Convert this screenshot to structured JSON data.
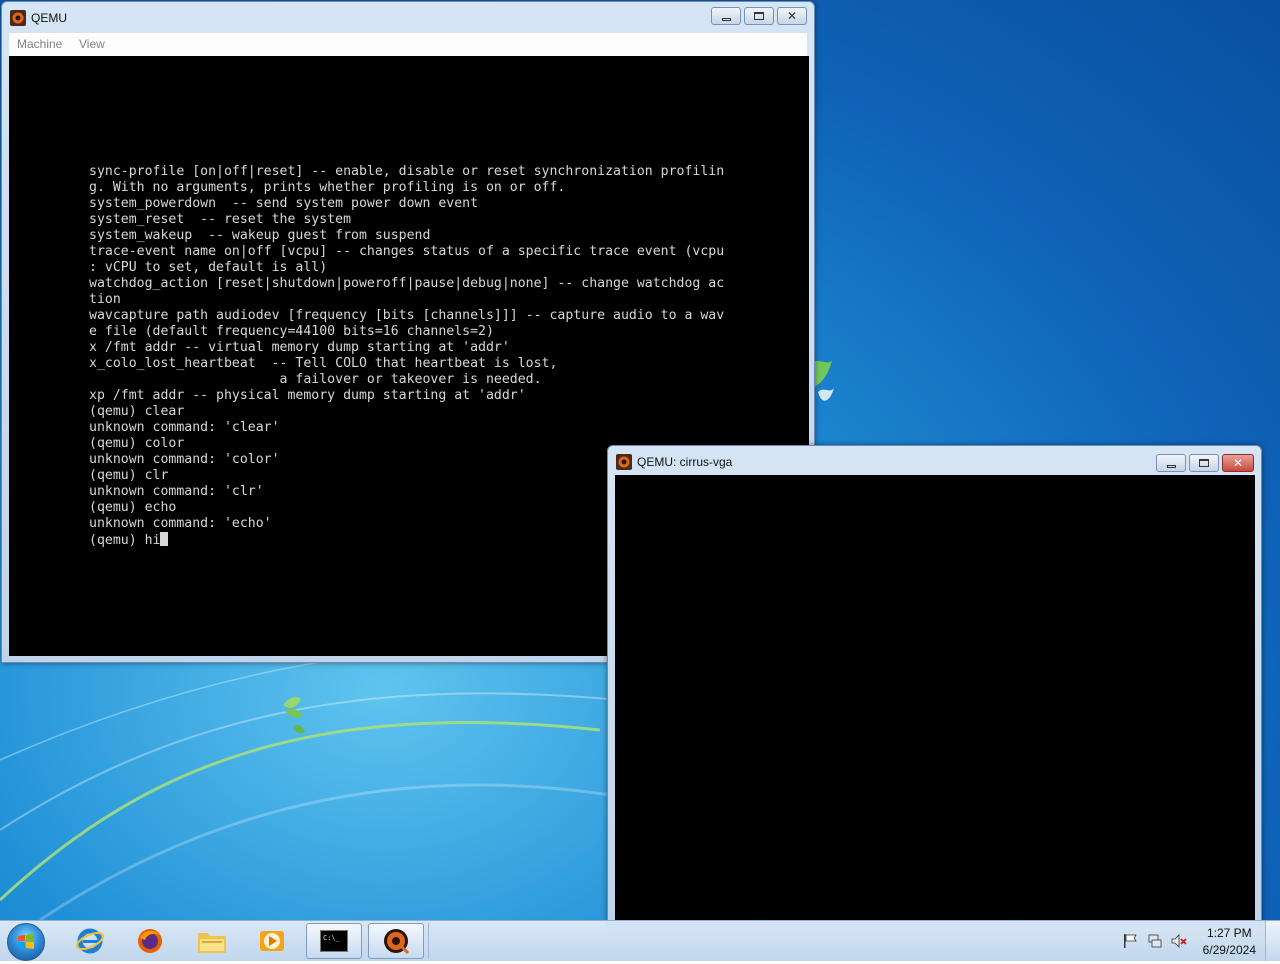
{
  "main_window": {
    "title": "QEMU",
    "menu": [
      "Machine",
      "View"
    ],
    "console_lines": [
      "sync-profile [on|off|reset] -- enable, disable or reset synchronization profilin",
      "g. With no arguments, prints whether profiling is on or off.",
      "system_powerdown  -- send system power down event",
      "system_reset  -- reset the system",
      "system_wakeup  -- wakeup guest from suspend",
      "trace-event name on|off [vcpu] -- changes status of a specific trace event (vcpu",
      ": vCPU to set, default is all)",
      "watchdog_action [reset|shutdown|poweroff|pause|debug|none] -- change watchdog ac",
      "tion",
      "wavcapture path audiodev [frequency [bits [channels]]] -- capture audio to a wav",
      "e file (default frequency=44100 bits=16 channels=2)",
      "x /fmt addr -- virtual memory dump starting at 'addr'",
      "x_colo_lost_heartbeat  -- Tell COLO that heartbeat is lost,",
      "                        a failover or takeover is needed.",
      "xp /fmt addr -- physical memory dump starting at 'addr'",
      "(qemu) clear",
      "unknown command: 'clear'",
      "(qemu) color",
      "unknown command: 'color'",
      "(qemu) clr",
      "unknown command: 'clr'",
      "(qemu) echo",
      "unknown command: 'echo'"
    ],
    "prompt_line": "(qemu) hi"
  },
  "second_window": {
    "title": "QEMU: cirrus-vga"
  },
  "taskbar": {
    "pinned_apps": [
      "internet-explorer",
      "firefox",
      "file-explorer",
      "media-player",
      "command-prompt",
      "qemu"
    ],
    "cmd_icon_text": "C:\\_",
    "clock_time": "1:27 PM",
    "clock_date": "6/29/2024"
  },
  "colors": {
    "console_bg": "#000000",
    "console_text": "#d7d7d7",
    "desktop_blue": "#1f8fd6"
  }
}
